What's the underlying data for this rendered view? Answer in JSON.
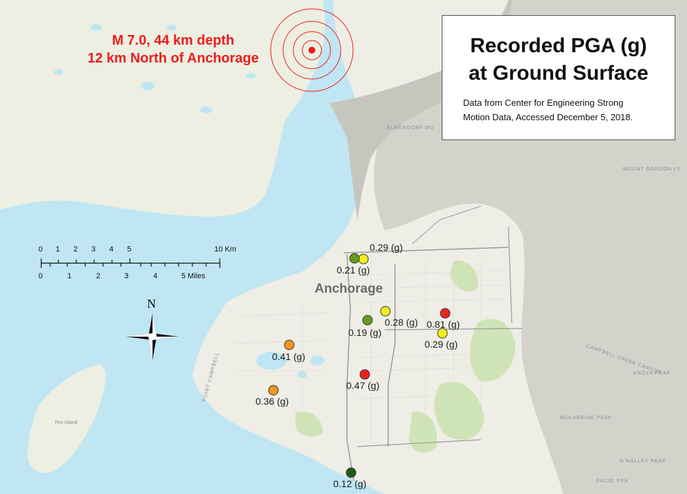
{
  "title": {
    "line1": "Recorded PGA (g)",
    "line2": "at Ground Surface",
    "source_line1": "Data from Center for Engineering Strong",
    "source_line2": "Motion Data, Accessed December 5, 2018."
  },
  "epicenter": {
    "line1": "M 7.0, 44 km depth",
    "line2": "12 km North of Anchorage",
    "color": "#ee1c1c"
  },
  "city_label": "Anchorage",
  "north_label": "N",
  "scale_bar": {
    "km_ticks": [
      "0",
      "1",
      "2",
      "3",
      "4",
      "5"
    ],
    "km_end": "10 Km",
    "mile_ticks": [
      "0",
      "1",
      "2",
      "3",
      "4"
    ],
    "mile_end": "5 Miles"
  },
  "stations": [
    {
      "label": "0.29 (g)",
      "pga": 0.29,
      "color": "#f2ee1d"
    },
    {
      "label": "0.21 (g)",
      "pga": 0.21,
      "color": "#6a9a1f"
    },
    {
      "label": "0.28 (g)",
      "pga": 0.28,
      "color": "#f2ee1d"
    },
    {
      "label": "0.19 (g)",
      "pga": 0.19,
      "color": "#6a9a1f"
    },
    {
      "label": "0.81 (g)",
      "pga": 0.81,
      "color": "#e8231f"
    },
    {
      "label": "0.29 (g)",
      "pga": 0.29,
      "color": "#f2ee1d"
    },
    {
      "label": "0.41 (g)",
      "pga": 0.41,
      "color": "#f0961e"
    },
    {
      "label": "0.47 (g)",
      "pga": 0.47,
      "color": "#e8231f"
    },
    {
      "label": "0.36 (g)",
      "pga": 0.36,
      "color": "#f0961e"
    },
    {
      "label": "0.12 (g)",
      "pga": 0.12,
      "color": "#1f5d18"
    }
  ],
  "map_labels": {
    "elmendorf": "ELMENDORF MO",
    "gordon": "MOUNT GORDON LY",
    "campbell_canyon": "CAMPBELL CREEK CANYON",
    "knoya": "KNOYA PEAK",
    "wolverine": "WOLVERINE PEAK",
    "omalley": "O'MALLEY PEAK",
    "false_peak": "FALSE PEA",
    "point_campbell": "POINT CAMPBELL",
    "fire_island": "Fire Island"
  },
  "colors": {
    "water": "#bfe6f2",
    "land": "#ecece4",
    "mountain": "#cfcfc8",
    "park": "#c9e2b0"
  }
}
